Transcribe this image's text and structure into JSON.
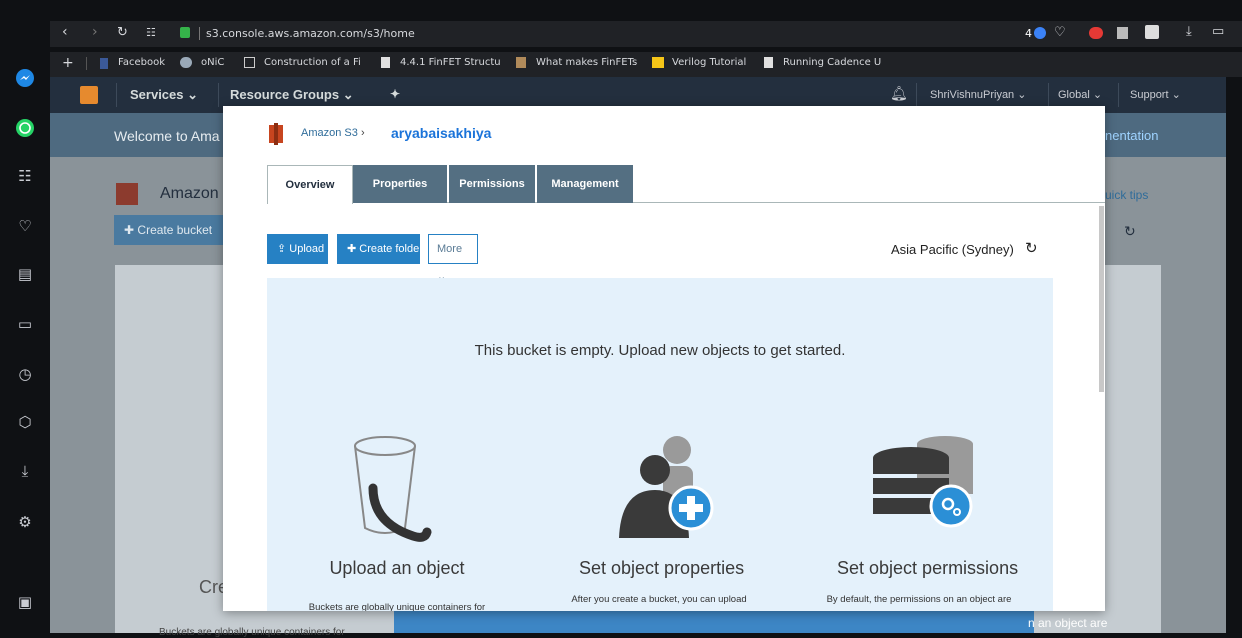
{
  "browser": {
    "url": "s3.console.aws.amazon.com/s3/home",
    "badge_count": "4",
    "bookmarks": [
      {
        "label": "Facebook",
        "icon": "facebook-icon"
      },
      {
        "label": "oNiC",
        "icon": "helmet-icon"
      },
      {
        "label": "Construction of a Fi",
        "icon": "grid-icon"
      },
      {
        "label": "4.4.1 FinFET Structu",
        "icon": "document-icon"
      },
      {
        "label": "What makes FinFETs",
        "icon": "figure-icon"
      },
      {
        "label": "Verilog Tutorial",
        "icon": "folder-icon"
      },
      {
        "label": "Running Cadence U",
        "icon": "document-icon"
      }
    ]
  },
  "aws_nav": {
    "services": "Services",
    "resource_groups": "Resource Groups",
    "user": "ShriVishnuPriyan",
    "region": "Global",
    "support": "Support"
  },
  "background": {
    "welcome_text": "Welcome to Ama",
    "welcome_right": "nentation",
    "amazon_title": "Amazon",
    "create_bucket": "Create bucket",
    "quick_tips": "uick tips",
    "cre_text": "Cre",
    "bottom_left_text": "Buckets are globally unique containers for",
    "bottom_right_text": "n an object are"
  },
  "modal": {
    "breadcrumb_root": "Amazon S3",
    "bucket_name": "aryabaisakhiya",
    "tabs": [
      "Overview",
      "Properties",
      "Permissions",
      "Management"
    ],
    "upload_label": "Upload",
    "create_folder_label": "Create folder",
    "more_label": "More",
    "region_label": "Asia Pacific (Sydney)",
    "empty_message": "This bucket is empty. Upload new objects to get started.",
    "features": [
      {
        "title": "Upload an object",
        "desc": "Buckets are globally unique containers for"
      },
      {
        "title": "Set object properties",
        "desc": "After you create a bucket, you can upload"
      },
      {
        "title": "Set object permissions",
        "desc": "By default, the permissions on an object are"
      }
    ]
  },
  "colors": {
    "aws_nav": "#232f3e",
    "accent_blue": "#2681c4",
    "tab_inactive": "#546f82",
    "empty_panel": "#e4f1fb"
  }
}
